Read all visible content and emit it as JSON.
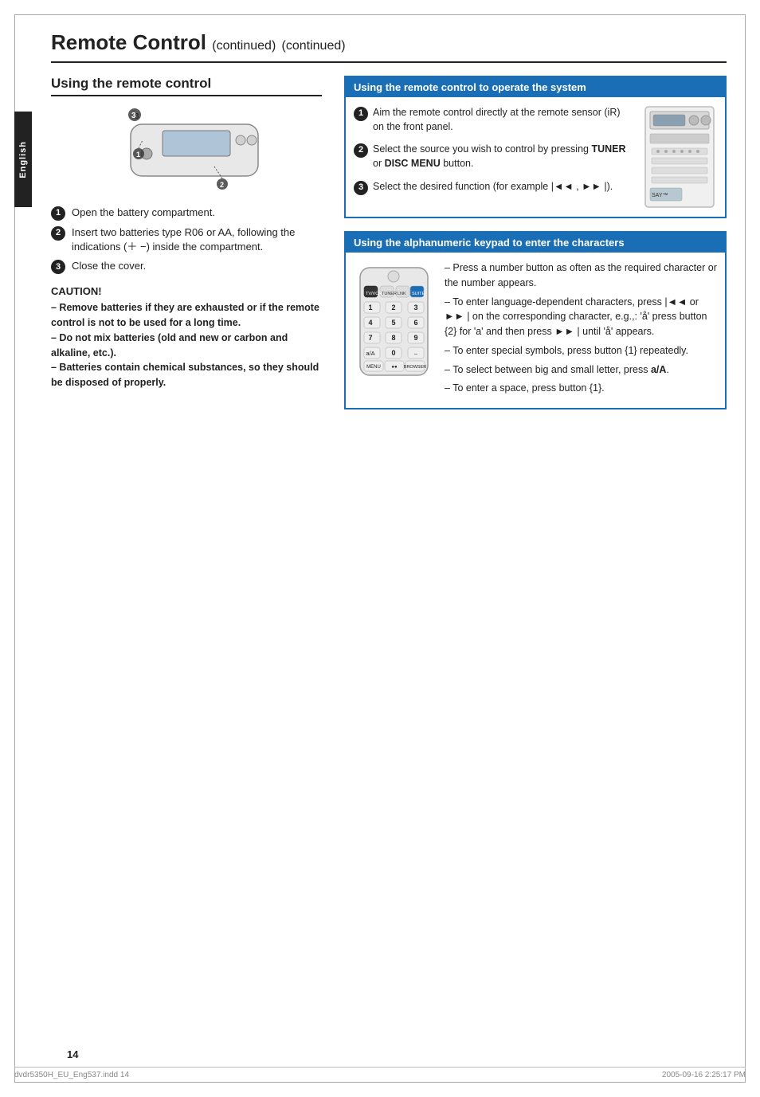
{
  "page": {
    "title": "Remote Control",
    "title_continued": "(continued)",
    "page_number": "14",
    "footer_left": "dvdr5350H_EU_Eng537.indd   14",
    "footer_right": "2005-09-16   2:25:17 PM"
  },
  "side_tab": {
    "label": "English"
  },
  "left_section": {
    "title": "Using the remote control",
    "steps": [
      {
        "num": "1",
        "text": "Open the battery compartment."
      },
      {
        "num": "2",
        "text": "Insert two batteries type R06 or AA, following the indications (＋ −) inside the compartment."
      },
      {
        "num": "3",
        "text": "Close the cover."
      }
    ],
    "caution": {
      "title": "CAUTION!",
      "lines": [
        "– Remove batteries if they are exhausted or if the remote control is not to be used for a long time.",
        "– Do not mix batteries (old and new or carbon and alkaline, etc.).",
        "– Batteries contain chemical substances, so they should be disposed of properly."
      ]
    }
  },
  "right_section1": {
    "title": "Using the remote control to operate the system",
    "steps": [
      {
        "num": "1",
        "text": "Aim the remote control directly at the remote sensor (iR) on the front panel."
      },
      {
        "num": "2",
        "text": "Select the source you wish to control by pressing TUNER or DISC MENU button."
      },
      {
        "num": "3",
        "text": "Select the desired function (for example |◄◄ , ►► |)."
      }
    ]
  },
  "right_section2": {
    "title": "Using the alphanumeric keypad to enter the characters",
    "instructions": [
      "– Press a number button as often as the required character or the number appears.",
      "– To enter language-dependent characters, press |◄◄ or ►► | on the corresponding character, e.g.,: 'å' press button {2} for 'a' and then press ►► | until 'å' appears.",
      "– To enter special symbols, press button {1} repeatedly.",
      "– To select between big and small letter, press a/A.",
      "– To enter a space, press button {1}."
    ]
  }
}
